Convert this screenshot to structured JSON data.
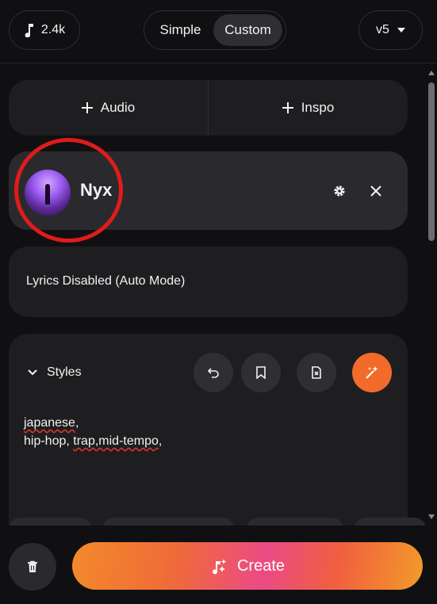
{
  "header": {
    "credits": "2.4k",
    "mode_options": [
      "Simple",
      "Custom"
    ],
    "selected_mode": "Custom",
    "version": "v5"
  },
  "add_row": {
    "audio_label": "Audio",
    "inspo_label": "Inspo"
  },
  "persona": {
    "name": "Nyx"
  },
  "lyrics": {
    "status": "Lyrics Disabled (Auto Mode)"
  },
  "styles": {
    "title": "Styles",
    "line1_word": "japanese",
    "line1_rest": ",",
    "line2_a": "hip-hop, ",
    "line2_squig": "trap,mid-tempo",
    "line2_end": ","
  },
  "footer": {
    "create_label": "Create"
  },
  "colors": {
    "accent_orange": "#f26b2b",
    "highlight_red": "#e01b1b",
    "background": "#101012"
  }
}
